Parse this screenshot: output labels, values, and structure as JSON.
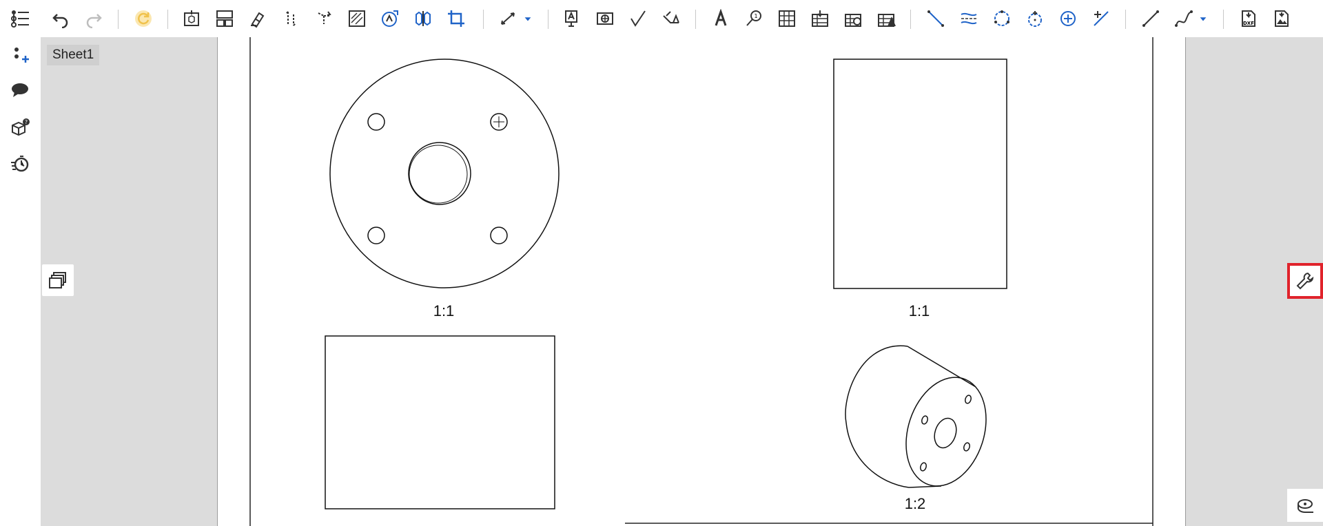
{
  "sheet_tab": {
    "label": "Sheet1"
  },
  "views": {
    "top_left_scale": "1:1",
    "top_right_scale": "1:1",
    "bottom_right_scale": "1:2"
  },
  "colors": {
    "accent": "#1f63c8",
    "highlight_border": "#e0232b",
    "canvas_bg": "#dcdcdc",
    "sheet_tab_bg": "#cfcfcf"
  },
  "toolbar": {
    "icons": [
      "undo-icon",
      "redo-icon",
      "update-icon",
      "insert-view-icon",
      "projected-view-icon",
      "section-view-icon",
      "auxiliary-view-icon",
      "rotated-view-icon",
      "detail-view-icon",
      "broken-view-icon",
      "alternate-view-icon",
      "crop-view-icon",
      "dimension-icon",
      "text-icon",
      "callout-icon",
      "table-icon",
      "centerline-icon",
      "annotation-icon",
      "bom-icon",
      "bend-table-icon",
      "hole-table-icon",
      "line-icon",
      "spline-icon",
      "export-dxf-icon",
      "export-image-icon"
    ]
  },
  "left_sidebar": {
    "icons": [
      "feature-list-icon",
      "add-point-icon",
      "comment-icon",
      "part-info-icon",
      "history-timer-icon"
    ]
  },
  "export": {
    "dxf_label": "DXF"
  }
}
